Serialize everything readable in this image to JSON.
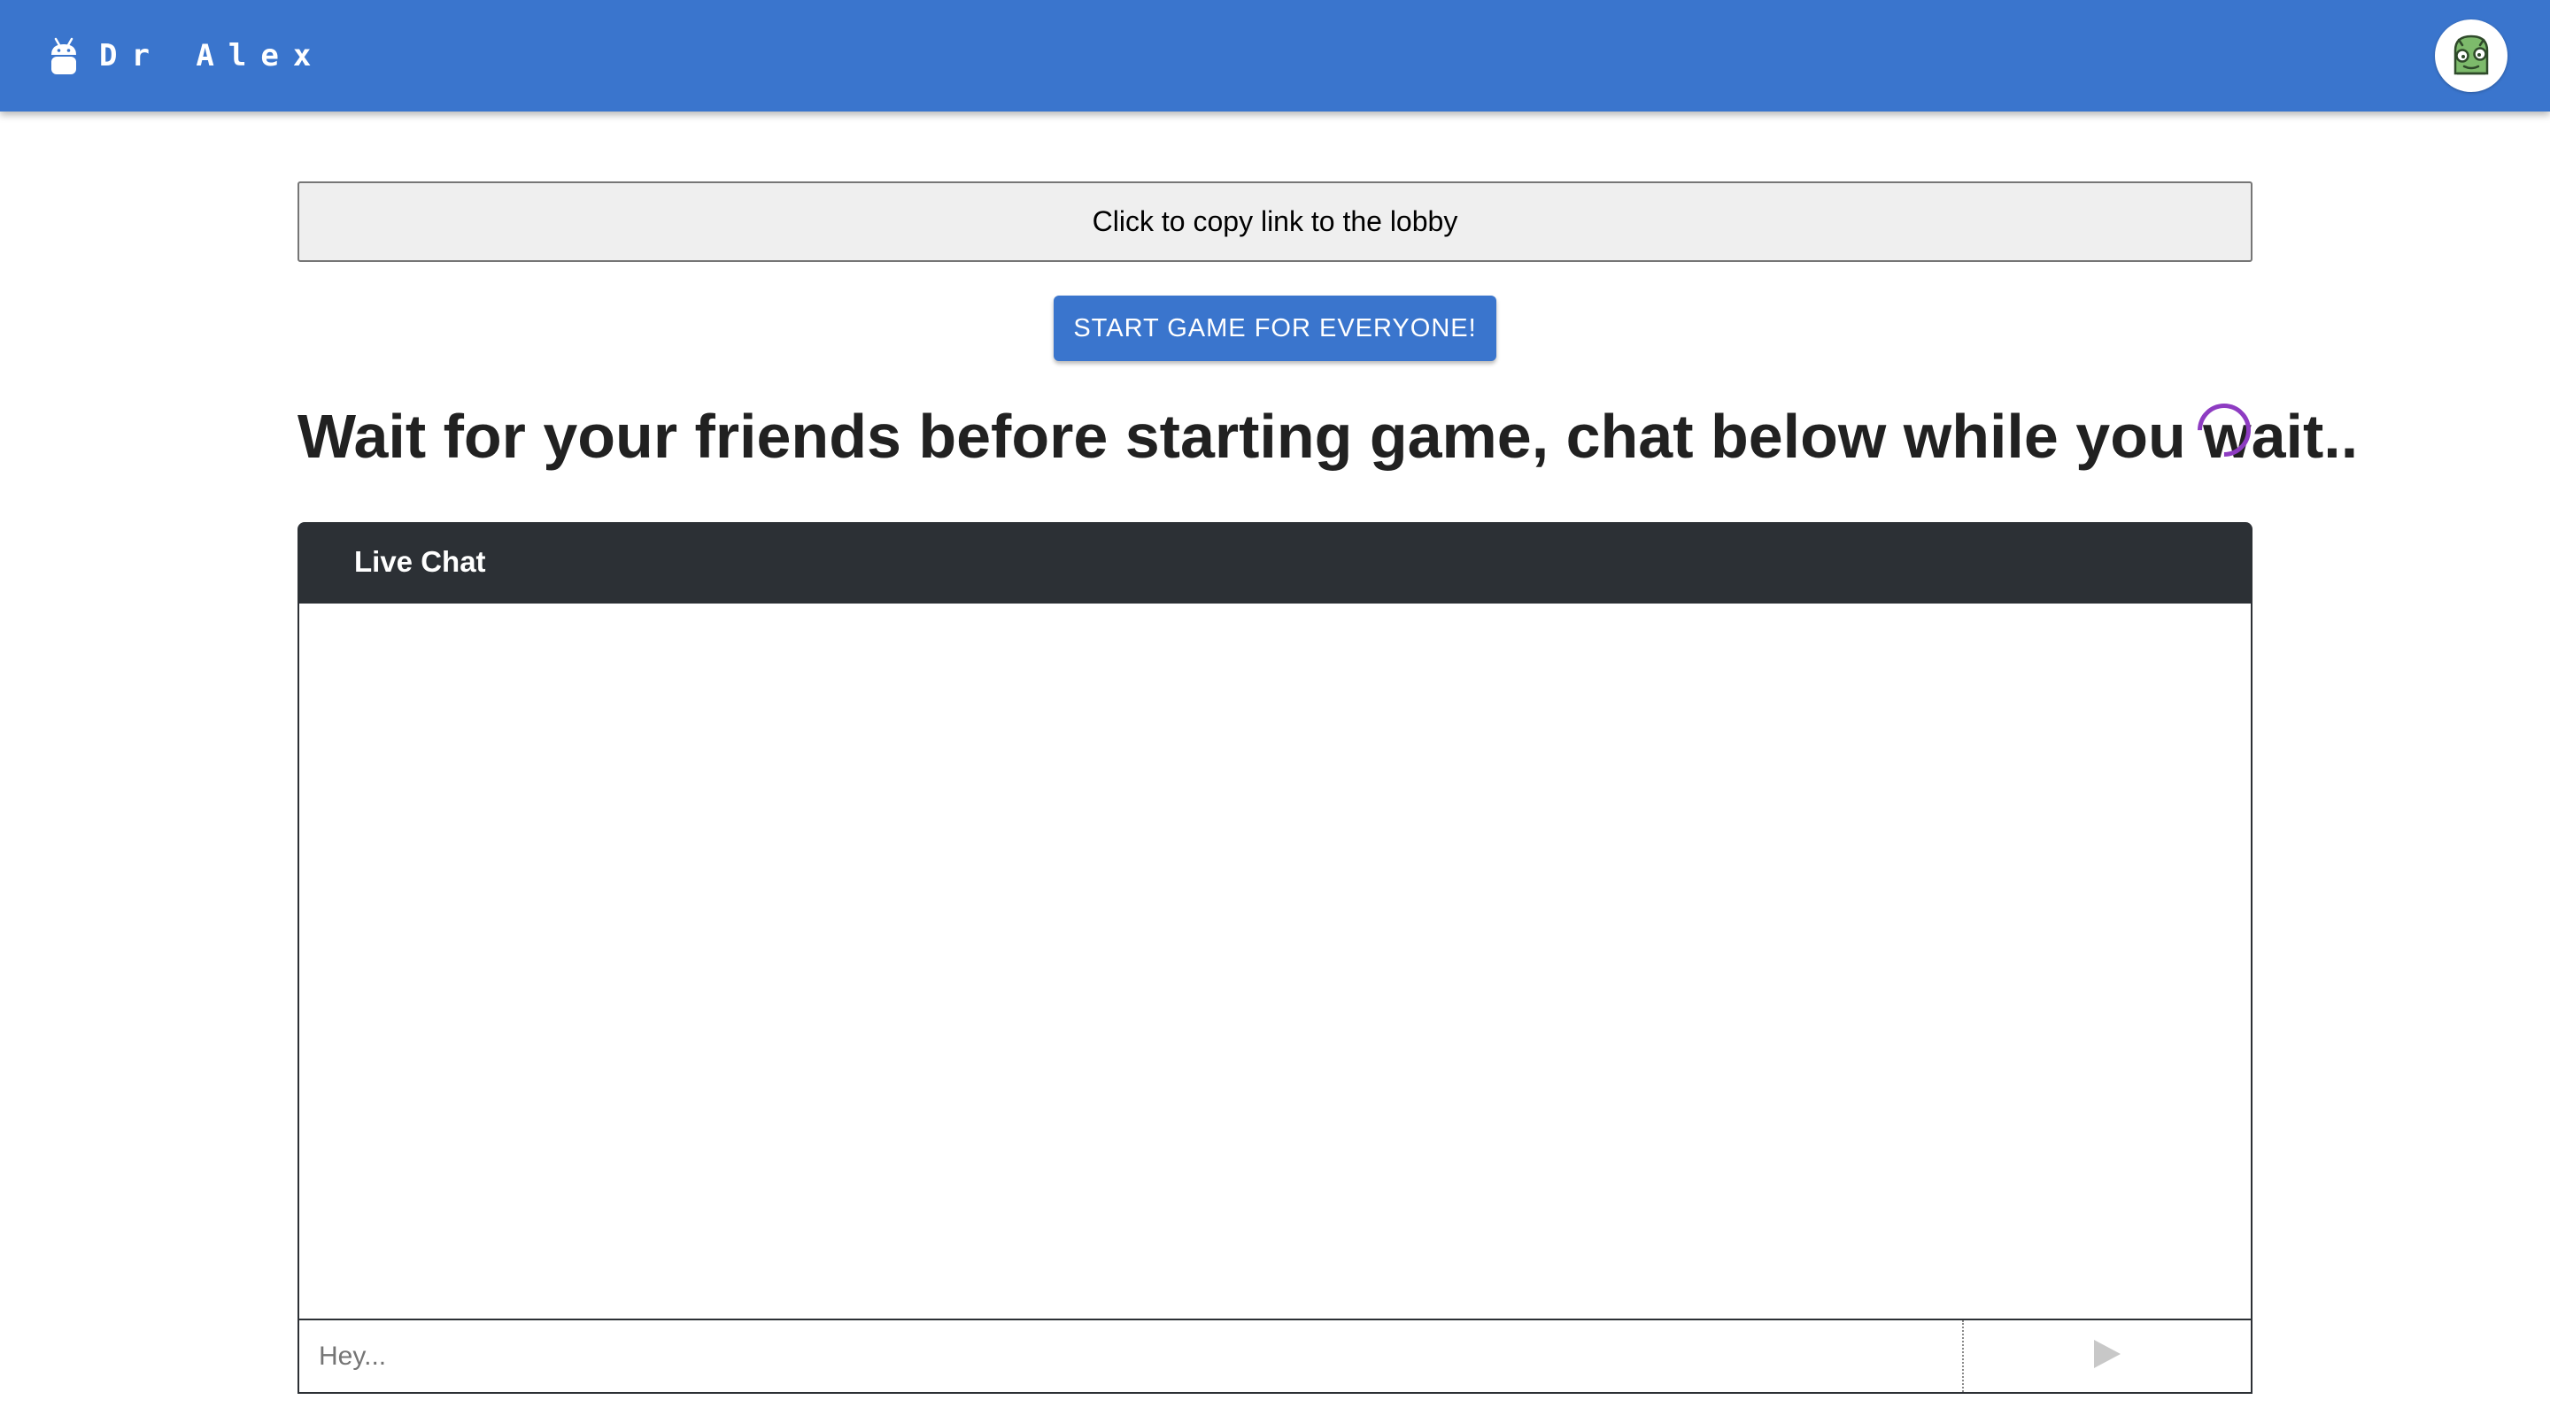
{
  "appbar": {
    "title": "Dr Alex",
    "logo_icon": "android-robot-icon",
    "avatar_icon": "green-monster-avatar-icon",
    "background_color": "#3a75cd"
  },
  "lobby": {
    "copy_link_label": "Click to copy link to the lobby",
    "start_button_label": "START GAME FOR EVERYONE!",
    "wait_heading": "Wait for your friends before starting game, chat below while you wait..",
    "spinner_color": "#8e3cc2"
  },
  "chat": {
    "title": "Live Chat",
    "messages": [],
    "input_placeholder": "Hey...",
    "input_value": "",
    "send_icon": "send-triangle-icon",
    "header_color": "#2c3035"
  }
}
